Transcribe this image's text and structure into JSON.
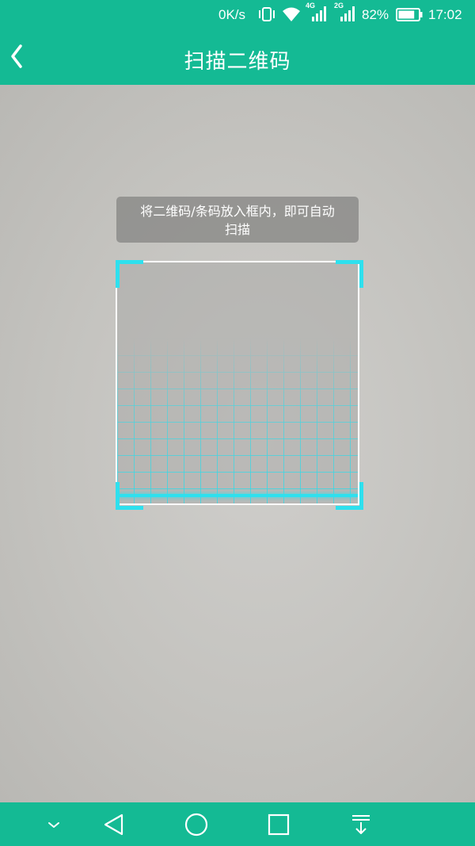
{
  "status_bar": {
    "net_speed": "0K/s",
    "signal_4g_label": "4G",
    "signal_2g_label": "2G",
    "battery_percent": "82%",
    "battery_level": 0.82,
    "time": "17:02"
  },
  "header": {
    "title": "扫描二维码",
    "back_icon": "chevron-left-icon"
  },
  "scanner": {
    "hint_line1": "将二维码/条码放入框内，即可自动",
    "hint_line2": "扫描"
  },
  "system_nav": {
    "icons": [
      "chevron-down-icon",
      "back-triangle-icon",
      "home-circle-icon",
      "recents-square-icon",
      "notification-pulldown-icon"
    ]
  },
  "colors": {
    "header_bg": "#14ba94",
    "scan_accent": "#2ee0ee",
    "camera_bg": "#c6c5c1"
  }
}
